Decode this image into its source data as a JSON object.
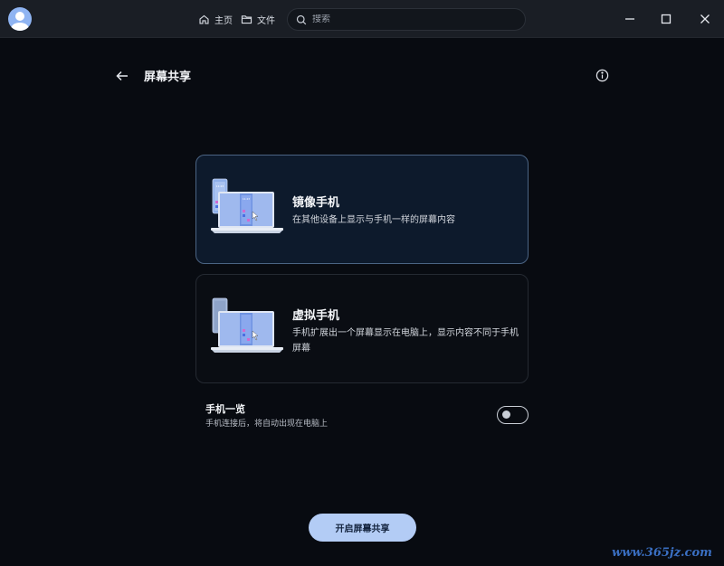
{
  "titlebar": {
    "nav_home": "主页",
    "nav_files": "文件",
    "search_placeholder": "搜索",
    "icons": [
      "avatar",
      "home-icon",
      "folder-icon",
      "search-icon",
      "minimize-icon",
      "maximize-icon",
      "close-icon"
    ]
  },
  "header": {
    "title": "屏幕共享",
    "icons": [
      "back-arrow-icon",
      "info-icon"
    ]
  },
  "options": [
    {
      "title": "镜像手机",
      "description": "在其他设备上显示与手机一样的屏幕内容",
      "selected": true,
      "phone_time": "11:23"
    },
    {
      "title": "虚拟手机",
      "description": "手机扩展出一个屏幕显示在电脑上，显示内容不同于手机屏幕",
      "selected": false
    }
  ],
  "phone_overview": {
    "title": "手机一览",
    "description": "手机连接后，将自动出现在电脑上",
    "enabled": false
  },
  "primary_button": "开启屏幕共享",
  "watermark": "www.365jz.com",
  "colors": {
    "background": "#080b11",
    "titlebar": "#1a1e25",
    "selected_card": "#0d1a2c",
    "selected_border": "#4b6483",
    "primary_button": "#b3ccf5"
  }
}
